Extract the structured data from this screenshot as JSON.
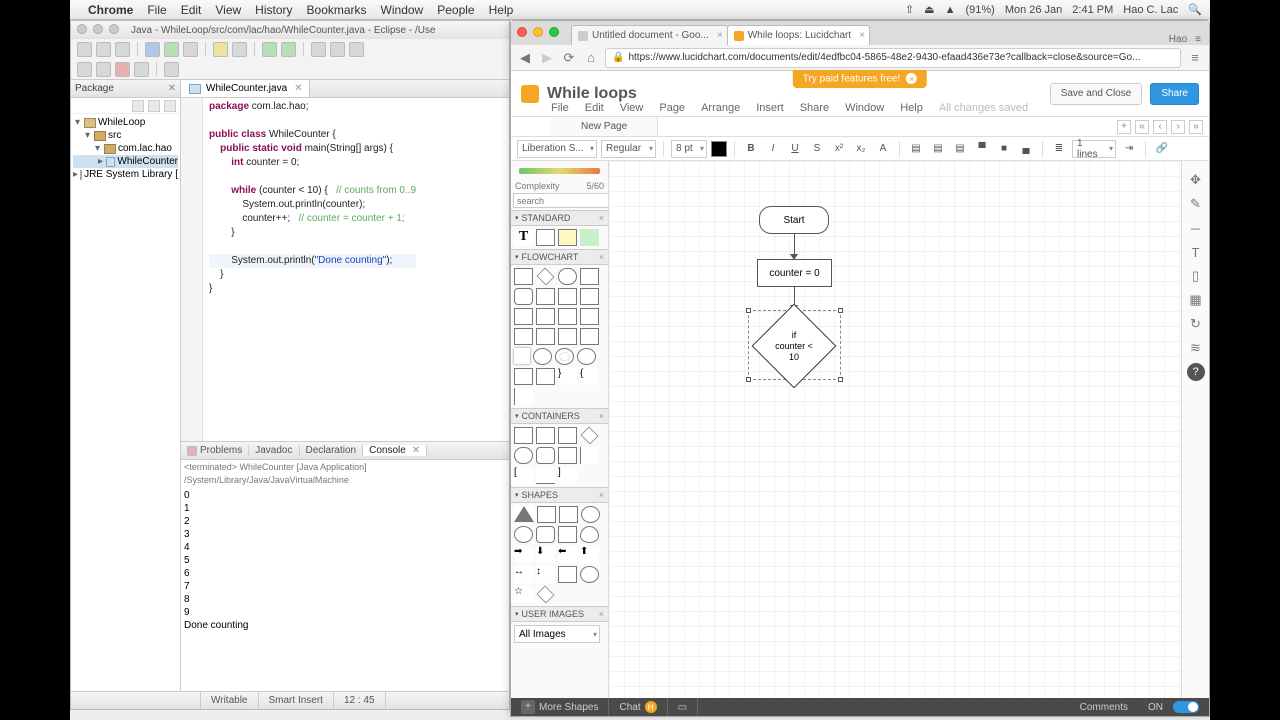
{
  "mac": {
    "app_name": "Chrome",
    "menus": [
      "File",
      "Edit",
      "View",
      "History",
      "Bookmarks",
      "Window",
      "People",
      "Help"
    ],
    "battery": "(91%)",
    "date": "Mon 26 Jan",
    "time": "2:41 PM",
    "user": "Hao C. Lac"
  },
  "eclipse": {
    "title": "Java - WhileLoop/src/com/lac/hao/WhileCounter.java - Eclipse - /Use",
    "package_view": "Package",
    "tree": {
      "project": "WhileLoop",
      "src": "src",
      "pkg": "com.lac.hao",
      "file": "WhileCounter",
      "lib": "JRE System Library ["
    },
    "editor_tab": "WhileCounter.java",
    "code": {
      "l1a": "package",
      "l1b": " com.lac.hao;",
      "l3a": "public class",
      "l3b": " WhileCounter {",
      "l4a": "public static void",
      "l4b": " main(String[] args) {",
      "l5a": "int",
      "l5b": " counter = 0;",
      "l7a": "while",
      "l7b": " (counter < 10) {   ",
      "l7c": "// counts from 0..9",
      "l8": "System.out.println(counter);",
      "l9a": "counter++;   ",
      "l9b": "// counter = counter + 1;",
      "l10": "}",
      "l12a": "System.out.println(",
      "l12b": "\"Done counting\"",
      "l12c": ");",
      "l13": "}",
      "l14": "}"
    },
    "views": {
      "problems": "Problems",
      "javadoc": "Javadoc",
      "declaration": "Declaration",
      "console": "Console"
    },
    "console_header": "<terminated> WhileCounter [Java Application] /System/Library/Java/JavaVirtualMachine",
    "console_out": [
      "0",
      "1",
      "2",
      "3",
      "4",
      "5",
      "6",
      "7",
      "8",
      "9",
      "Done counting"
    ],
    "status": {
      "writable": "Writable",
      "insert": "Smart Insert",
      "pos": "12 : 45"
    }
  },
  "chrome": {
    "tabs": [
      {
        "label": "Untitled document - Goo..."
      },
      {
        "label": "While loops: Lucidchart"
      }
    ],
    "profile": "Hao",
    "url": "https://www.lucidchart.com/documents/edit/4edfbc04-5865-48e2-9430-efaad436e73e?callback=close&source=Go..."
  },
  "lucid": {
    "promo": "Try paid features free!",
    "doc_title": "While loops",
    "menu": [
      "File",
      "Edit",
      "View",
      "Page",
      "Arrange",
      "Insert",
      "Share",
      "Window",
      "Help"
    ],
    "saved": "All changes saved",
    "save_btn": "Save and Close",
    "share_btn": "Share",
    "page_tab": "New Page",
    "toolbar": {
      "font": "Liberation S...",
      "weight": "Regular",
      "size": "8 pt",
      "lines": "1 lines"
    },
    "panel": {
      "complexity_label": "Complexity",
      "complexity_val": "5/60",
      "search_ph": "search",
      "cats": {
        "standard": "STANDARD",
        "flowchart": "FLOWCHART",
        "containers": "CONTAINERS",
        "shapes": "SHAPES",
        "user": "USER IMAGES"
      },
      "all_images": "All Images"
    },
    "nodes": {
      "start": "Start",
      "init": "counter = 0",
      "cond": "if\ncounter <\n10"
    },
    "footer": {
      "more": "More Shapes",
      "chat": "Chat",
      "chat_badge": "H",
      "comments": "Comments",
      "on": "ON"
    }
  }
}
